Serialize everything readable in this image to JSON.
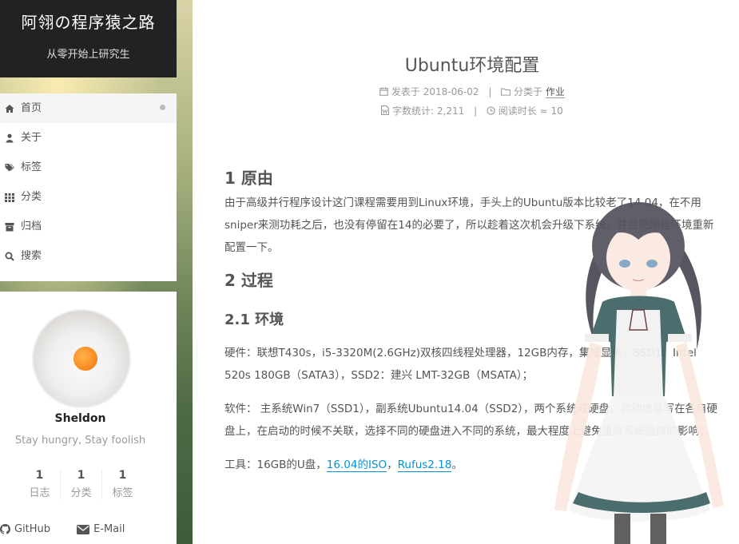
{
  "site": {
    "title": "阿翎の程序猿之路",
    "subtitle": "从零开始上研究生"
  },
  "menu": {
    "items": [
      {
        "label": "首页",
        "icon": "home-icon",
        "active": true
      },
      {
        "label": "关于",
        "icon": "user-icon"
      },
      {
        "label": "标签",
        "icon": "tags-icon"
      },
      {
        "label": "分类",
        "icon": "grid-icon"
      },
      {
        "label": "归档",
        "icon": "archive-icon"
      },
      {
        "label": "搜索",
        "icon": "search-icon"
      }
    ]
  },
  "author": {
    "name": "Sheldon",
    "motto": "Stay hungry, Stay foolish",
    "stats": [
      {
        "num": "1",
        "label": "日志"
      },
      {
        "num": "1",
        "label": "分类"
      },
      {
        "num": "1",
        "label": "标签"
      }
    ],
    "links": {
      "github": "GitHub",
      "email": "E-Mail"
    }
  },
  "post": {
    "title": "Ubuntu环境配置",
    "meta": {
      "posted_label": "发表于",
      "date": "2018-06-02",
      "category_label": "分类于",
      "category": "作业",
      "wordcount_label": "字数统计:",
      "wordcount": "2,211",
      "readtime_label": "阅读时长 ≈",
      "readtime": "10"
    },
    "sections": {
      "h_reason": "1 原由",
      "p_reason": "由于高级并行程序设计这门课程需要用到Linux环境，手头上的Ubuntu版本比较老了14.04，在不用sniper来测功耗之后，也没有停留在14的必要了，所以趁着这次机会升级下系统，并且把编程环境重新配置一下。",
      "h_process": "2 过程",
      "h_env": "2.1 环境",
      "p_hardware": "硬件：联想T430s，i5-3320M(2.6GHz)双核四线程处理器，12GB内存，集成显卡，SSD1：Intel 520s 180GB（SATA3），SSD2：建兴 LMT-32GB（MSATA）；",
      "p_software": "软件： 主系统Win7（SSD1），副系统Ubuntu14.04（SSD2），两个系统双硬盘，启动信息写在各自硬盘上，在启动的时候不关联，选择不同的硬盘进入不同的系统，最大程度上避免重装系统造成的影响；",
      "p_tools_prefix": "工具：16GB的U盘，",
      "link_iso": "16.04的ISO",
      "tools_comma": "，",
      "link_rufus": "Rufus2.18",
      "tools_end": "。"
    }
  }
}
